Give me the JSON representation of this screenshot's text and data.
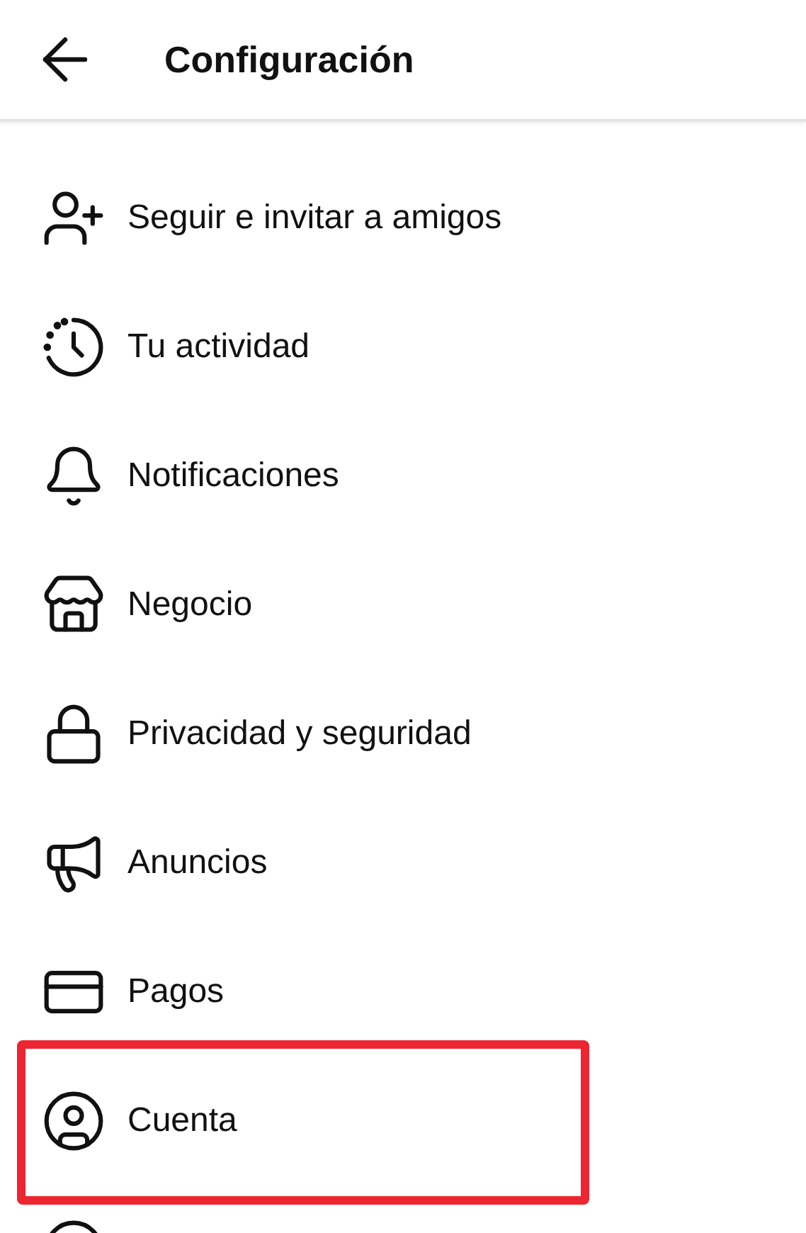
{
  "header": {
    "title": "Configuración"
  },
  "items": [
    {
      "kind": "follow",
      "label": "Seguir e invitar a amigos",
      "highlighted": false
    },
    {
      "kind": "activity",
      "label": "Tu actividad",
      "highlighted": false
    },
    {
      "kind": "notifications",
      "label": "Notificaciones",
      "highlighted": false
    },
    {
      "kind": "business",
      "label": "Negocio",
      "highlighted": false
    },
    {
      "kind": "privacy",
      "label": "Privacidad y seguridad",
      "highlighted": false
    },
    {
      "kind": "ads",
      "label": "Anuncios",
      "highlighted": false
    },
    {
      "kind": "payments",
      "label": "Pagos",
      "highlighted": false
    },
    {
      "kind": "account",
      "label": "Cuenta",
      "highlighted": true
    },
    {
      "kind": "help",
      "highlighted": false
    }
  ]
}
